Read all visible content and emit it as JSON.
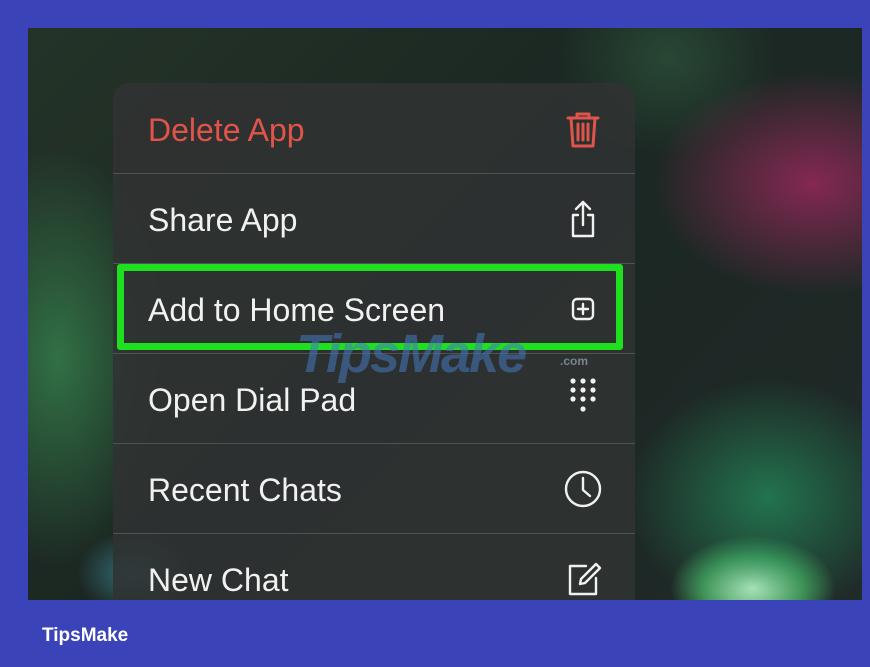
{
  "menu": {
    "items": [
      {
        "label": "Delete App",
        "icon": "trash-icon",
        "destructive": true
      },
      {
        "label": "Share App",
        "icon": "share-icon"
      },
      {
        "label": "Add to Home Screen",
        "icon": "add-square-icon",
        "highlighted": true
      },
      {
        "label": "Open Dial Pad",
        "icon": "dial-pad-icon"
      },
      {
        "label": "Recent Chats",
        "icon": "clock-icon"
      },
      {
        "label": "New Chat",
        "icon": "compose-icon"
      }
    ]
  },
  "watermark": {
    "text": "TipsMake",
    "suffix": ".com"
  },
  "footer": {
    "brand": "TipsMake"
  },
  "colors": {
    "frame": "#3a44b8",
    "destructive": "#e0544a",
    "highlight": "#1fe01f",
    "menu_text": "#f1f1f1"
  }
}
